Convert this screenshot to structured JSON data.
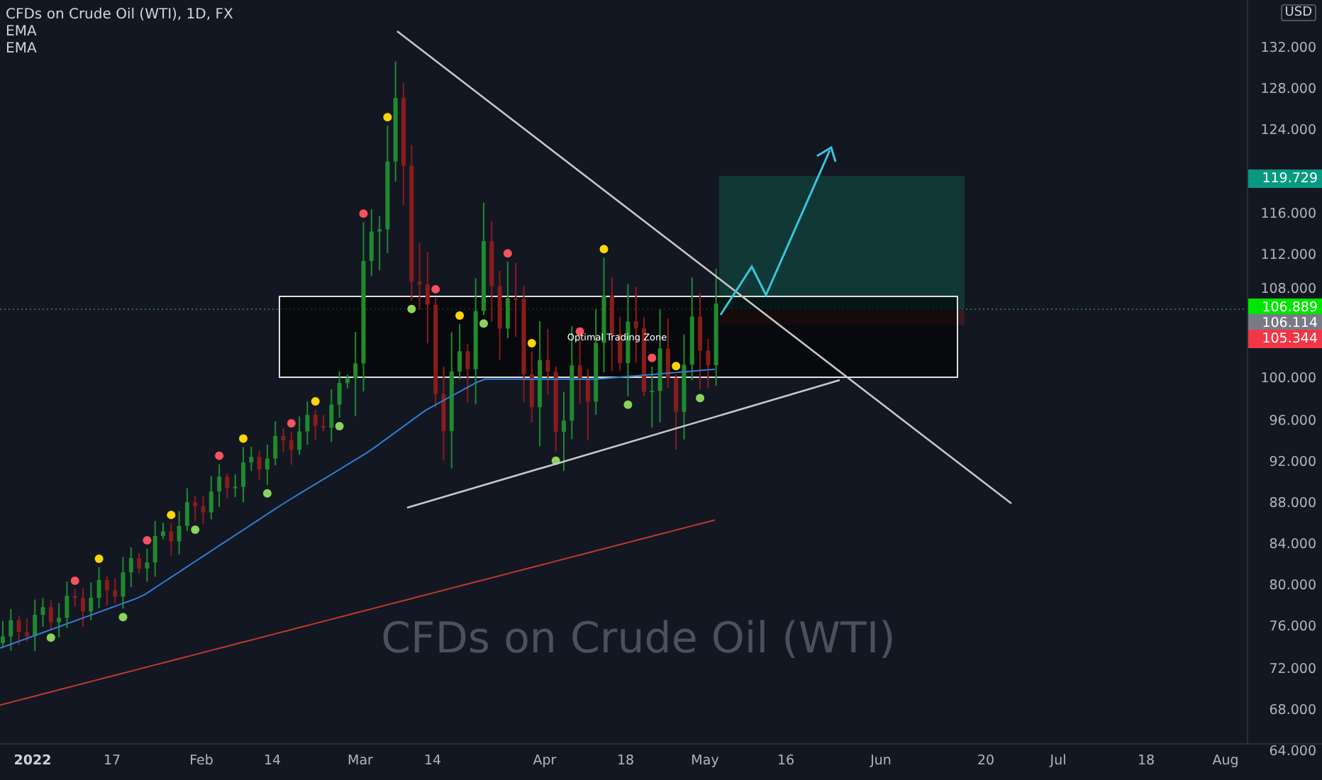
{
  "legend": {
    "title": "CFDs on Crude Oil (WTI), 1D, FX",
    "indicators": [
      "EMA",
      "EMA"
    ]
  },
  "symbol_watermark": "CFDs on Crude Oil (WTI)",
  "zone": {
    "label": "Optimal Trading Zone"
  },
  "price_axis": {
    "currency": "USD",
    "ticks": [
      "132.000",
      "128.000",
      "124.000",
      "116.000",
      "112.000",
      "108.000",
      "100.000",
      "96.000",
      "92.000",
      "88.000",
      "84.000",
      "80.000",
      "76.000",
      "72.000",
      "68.000",
      "64.000"
    ]
  },
  "price_labels": [
    {
      "text": "119.729",
      "color": "#089981"
    },
    {
      "text": "106.889",
      "color": "#00e600"
    },
    {
      "text": "106.114",
      "color": "#787b86"
    },
    {
      "text": "105.344",
      "color": "#f23645"
    }
  ],
  "time_axis": {
    "ticks": [
      {
        "label": "2022",
        "kind": "year"
      },
      {
        "label": "17",
        "kind": "day"
      },
      {
        "label": "Feb",
        "kind": "month"
      },
      {
        "label": "14",
        "kind": "day"
      },
      {
        "label": "Mar",
        "kind": "month"
      },
      {
        "label": "14",
        "kind": "day"
      },
      {
        "label": "Apr",
        "kind": "month"
      },
      {
        "label": "18",
        "kind": "day"
      },
      {
        "label": "May",
        "kind": "month"
      },
      {
        "label": "16",
        "kind": "day"
      },
      {
        "label": "Jun",
        "kind": "month"
      },
      {
        "label": "20",
        "kind": "day"
      },
      {
        "label": "Jul",
        "kind": "month"
      },
      {
        "label": "18",
        "kind": "day"
      },
      {
        "label": "Aug",
        "kind": "month"
      }
    ]
  }
}
